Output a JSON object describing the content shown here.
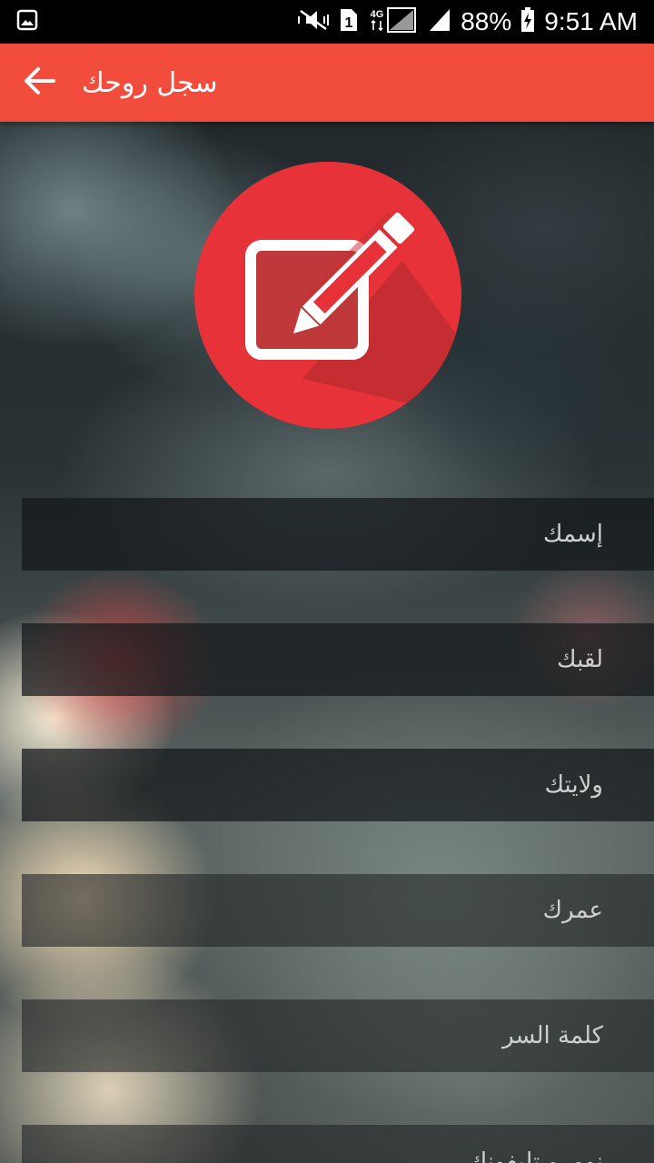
{
  "status_bar": {
    "battery_percent": "88%",
    "time": "9:51 AM",
    "network": "4G",
    "sim_slot": "1",
    "icons": [
      "gallery-icon",
      "mute-icon",
      "sim-1-icon",
      "4g-signal-icon",
      "signal-icon",
      "battery-charging-icon"
    ]
  },
  "app_bar": {
    "title": "سجل روحك",
    "back_icon": "arrow-back-icon",
    "color": "#f24c3d"
  },
  "logo": {
    "icon": "edit-register-icon",
    "color": "#e8323a"
  },
  "form": {
    "fields": [
      {
        "placeholder": "إسمك"
      },
      {
        "placeholder": "لقبك"
      },
      {
        "placeholder": "ولايتك"
      },
      {
        "placeholder": "عمرك"
      },
      {
        "placeholder": "كلمة السر"
      },
      {
        "placeholder": "نومرو تليفونك"
      }
    ]
  }
}
